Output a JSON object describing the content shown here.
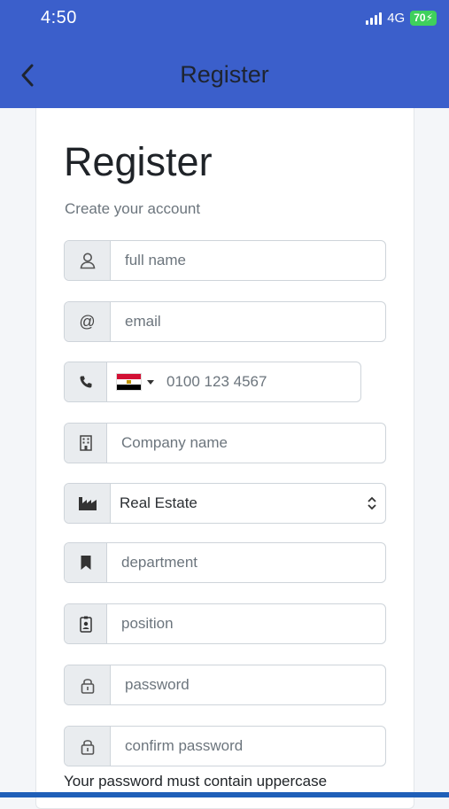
{
  "status": {
    "time": "4:50",
    "network": "4G",
    "battery": "70"
  },
  "nav": {
    "title": "Register"
  },
  "form": {
    "heading": "Register",
    "subtitle": "Create your account",
    "full_name_placeholder": "full name",
    "email_placeholder": "email",
    "phone_placeholder": "0100 123 4567",
    "company_placeholder": "Company name",
    "industry_selected": "Real Estate",
    "department_placeholder": "department",
    "position_placeholder": "position",
    "password_placeholder": "password",
    "confirm_password_placeholder": "confirm password",
    "password_hint": "Your password must contain uppercase"
  },
  "colors": {
    "header": "#3b5fcb",
    "addon": "#e9ecef",
    "battery": "#3fd05c"
  },
  "icons": [
    "back-arrow-icon",
    "user-icon",
    "at-icon",
    "phone-icon",
    "egypt-flag-icon",
    "building-icon",
    "industry-icon",
    "bookmark-icon",
    "id-badge-icon",
    "lock-icon",
    "select-arrows-icon"
  ]
}
